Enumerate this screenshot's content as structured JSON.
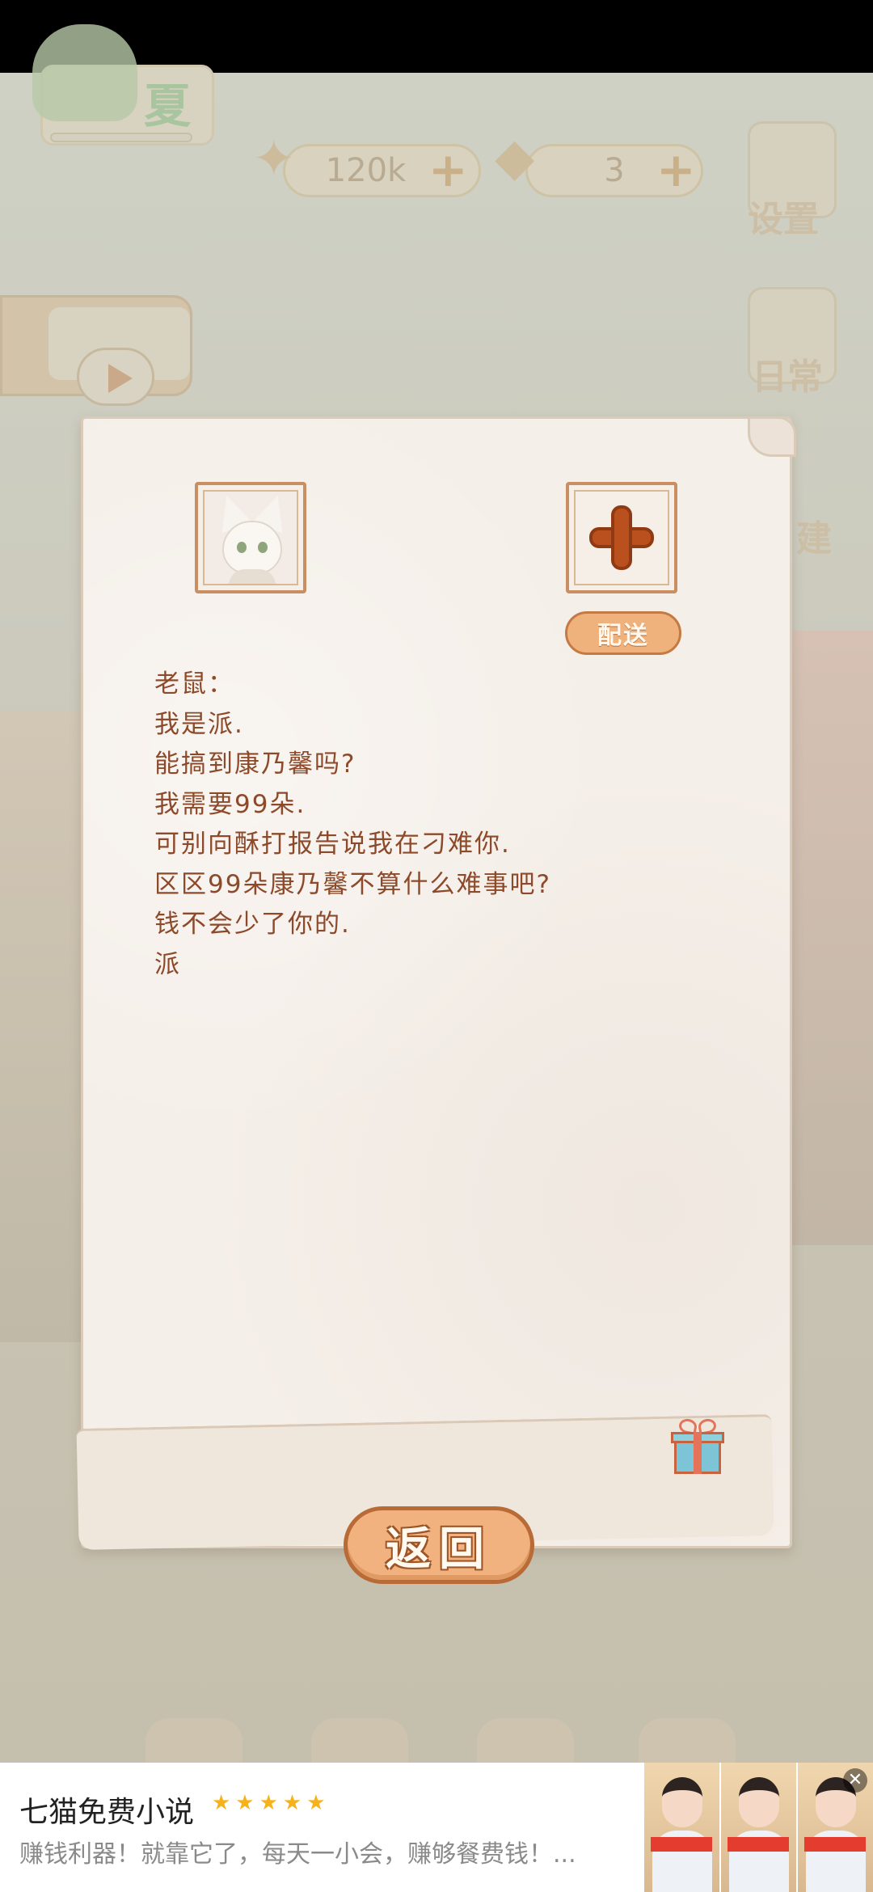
{
  "hud": {
    "season_label": "夏",
    "fish_amount": "120k",
    "cheese_amount": "3",
    "settings_label": "设置",
    "daily_label": "日常",
    "build_label": "建"
  },
  "letter": {
    "deliver_label": "配送",
    "lines": [
      "老鼠：",
      "我是派.",
      "能搞到康乃馨吗?",
      "我需要99朵.",
      "可别向酥打报告说我在刁难你.",
      "区区99朵康乃馨不算什么难事吧?",
      "钱不会少了你的.",
      "派"
    ],
    "return_label": "返回"
  },
  "ad": {
    "title": "七猫免费小说",
    "stars": "★★★★★",
    "description": "赚钱利器！就靠它了，每天一小会，赚够餐费钱！...",
    "close": "✕"
  },
  "icons": {
    "fish": "fish-icon",
    "cheese": "cheese-icon",
    "plus": "plus-icon",
    "gift": "gift-icon",
    "play": "play-icon"
  }
}
